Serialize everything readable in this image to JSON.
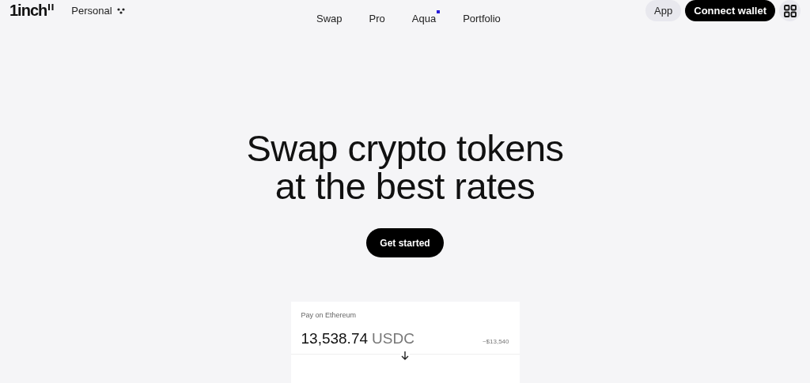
{
  "header": {
    "logo": "1inch",
    "account": "Personal",
    "nav": [
      {
        "label": "Swap",
        "dot": false
      },
      {
        "label": "Pro",
        "dot": false
      },
      {
        "label": "Aqua",
        "dot": true
      },
      {
        "label": "Portfolio",
        "dot": false
      }
    ],
    "app_button": "App",
    "connect_button": "Connect wallet"
  },
  "hero": {
    "title_lines": [
      "Swap crypto tokens",
      "at the best rates"
    ],
    "cta": "Get started"
  },
  "swap_card": {
    "label": "Pay on Ethereum",
    "amount": "13,538.74",
    "token": "USDC",
    "usd_value": "~$13,540"
  }
}
